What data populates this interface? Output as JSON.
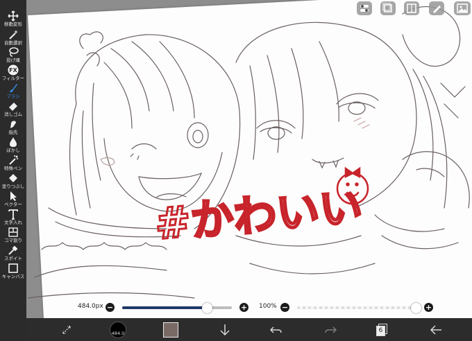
{
  "toolbar": {
    "tools": [
      {
        "label": "移動変形",
        "icon": "move-icon"
      },
      {
        "label": "自動選択",
        "icon": "magic-wand-icon"
      },
      {
        "label": "投げ縄",
        "icon": "lasso-icon"
      },
      {
        "label": "フィルター",
        "icon": "fx-icon"
      },
      {
        "label": "ブラシ",
        "icon": "brush-icon"
      },
      {
        "label": "消しゴム",
        "icon": "eraser-icon"
      },
      {
        "label": "指先",
        "icon": "finger-icon"
      },
      {
        "label": "ぼかし",
        "icon": "blur-drop-icon"
      },
      {
        "label": "特殊ペン",
        "icon": "special-pen-icon"
      },
      {
        "label": "塗りつぶし",
        "icon": "bucket-icon"
      },
      {
        "label": "ベクター",
        "icon": "vector-cursor-icon"
      },
      {
        "label": "文字入れ",
        "icon": "text-icon"
      },
      {
        "label": "コマ割り",
        "icon": "frame-divider-icon"
      },
      {
        "label": "スポイト",
        "icon": "eyedropper-icon"
      },
      {
        "label": "キャンバス",
        "icon": "canvas-icon"
      }
    ],
    "active_tool": "ブラシ"
  },
  "top_buttons": [
    "toggle-icon",
    "layers-icon",
    "frame-icon",
    "pen-icon",
    "image-icon"
  ],
  "brush_size": {
    "value_label": "484.0px",
    "fraction": 0.77
  },
  "opacity": {
    "value_label": "100%",
    "fraction": 0.96
  },
  "bottom_bar": {
    "brush_indicator_label": "484.0",
    "color_swatch": "#7a6a66",
    "layer_count": "6",
    "icons": [
      "transform-selection-icon",
      "brush-size-indicator",
      "color-swatch",
      "import-down-arrow-icon",
      "undo-icon",
      "redo-icon",
      "layer-count-icon",
      "back-arrow-icon"
    ]
  },
  "artwork": {
    "caption": "#かわいい",
    "caption_color": "#c8242b",
    "line_color": "#5c5052"
  }
}
